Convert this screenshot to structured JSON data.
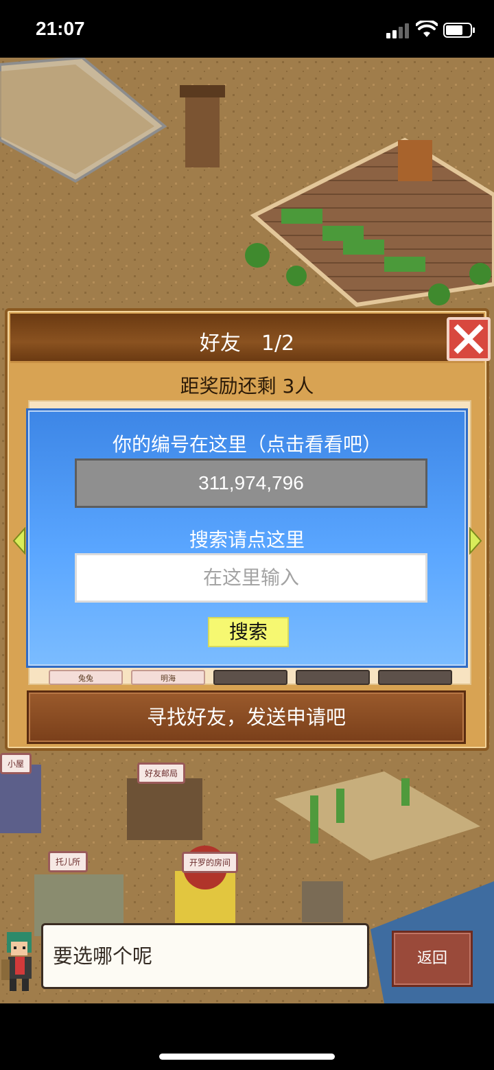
{
  "status_bar": {
    "time": "21:07",
    "signal_icon": "cellular-signal-icon",
    "wifi_icon": "wifi-icon",
    "battery_icon": "battery-icon"
  },
  "scene": {
    "building_tags": {
      "small_house": "小屋",
      "friend_post": "好友邮局",
      "daycare": "托儿所",
      "kairo_room": "开罗的房间"
    }
  },
  "dialog": {
    "title": "好友　1/2",
    "close_icon": "close-x-icon",
    "reward_progress": "距奖励还剩 3人",
    "friend_slot_labels": [
      "兔兔",
      "明海",
      "",
      "",
      ""
    ],
    "id_caption": "你的编号在这里（点击看看吧）",
    "player_id": "311,974,796",
    "search_caption": "搜索请点这里",
    "search_placeholder": "在这里输入",
    "search_button": "搜索",
    "find_friends_button": "寻找好友，发送申请吧",
    "prev_icon": "arrow-left-icon",
    "next_icon": "arrow-right-icon"
  },
  "bottom": {
    "prompt": "要选哪个呢",
    "back_button": "返回"
  },
  "colors": {
    "dialog_bg": "#d8a353",
    "id_panel": "#5aa6ff",
    "search_button": "#f6f871",
    "close_button": "#d8483e"
  }
}
